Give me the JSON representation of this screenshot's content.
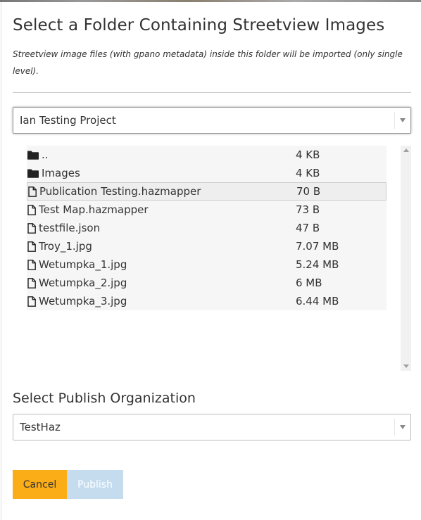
{
  "dialog": {
    "title": "Select a Folder Containing Streetview Images",
    "subtitle": "Streetview image files (with gpano metadata) inside this folder will be imported (only single level)."
  },
  "project_select": {
    "value": "Ian Testing Project"
  },
  "files": [
    {
      "type": "folder",
      "name": "..",
      "size": "4 KB",
      "selected": false
    },
    {
      "type": "folder",
      "name": "Images",
      "size": "4 KB",
      "selected": false
    },
    {
      "type": "file",
      "name": "Publication Testing.hazmapper",
      "size": "70 B",
      "selected": true
    },
    {
      "type": "file",
      "name": "Test Map.hazmapper",
      "size": "73 B",
      "selected": false
    },
    {
      "type": "file",
      "name": "testfile.json",
      "size": "47 B",
      "selected": false
    },
    {
      "type": "file",
      "name": "Troy_1.jpg",
      "size": "7.07 MB",
      "selected": false
    },
    {
      "type": "file",
      "name": "Wetumpka_1.jpg",
      "size": "5.24 MB",
      "selected": false
    },
    {
      "type": "file",
      "name": "Wetumpka_2.jpg",
      "size": "6 MB",
      "selected": false
    },
    {
      "type": "file",
      "name": "Wetumpka_3.jpg",
      "size": "6.44 MB",
      "selected": false
    }
  ],
  "org_section": {
    "label": "Select Publish Organization",
    "value": "TestHaz"
  },
  "buttons": {
    "cancel": "Cancel",
    "publish": "Publish"
  },
  "icons": {
    "folder": "folder-icon",
    "file": "file-icon"
  },
  "colors": {
    "cancel_bg": "#fbad17",
    "publish_bg": "#c5dcef"
  }
}
